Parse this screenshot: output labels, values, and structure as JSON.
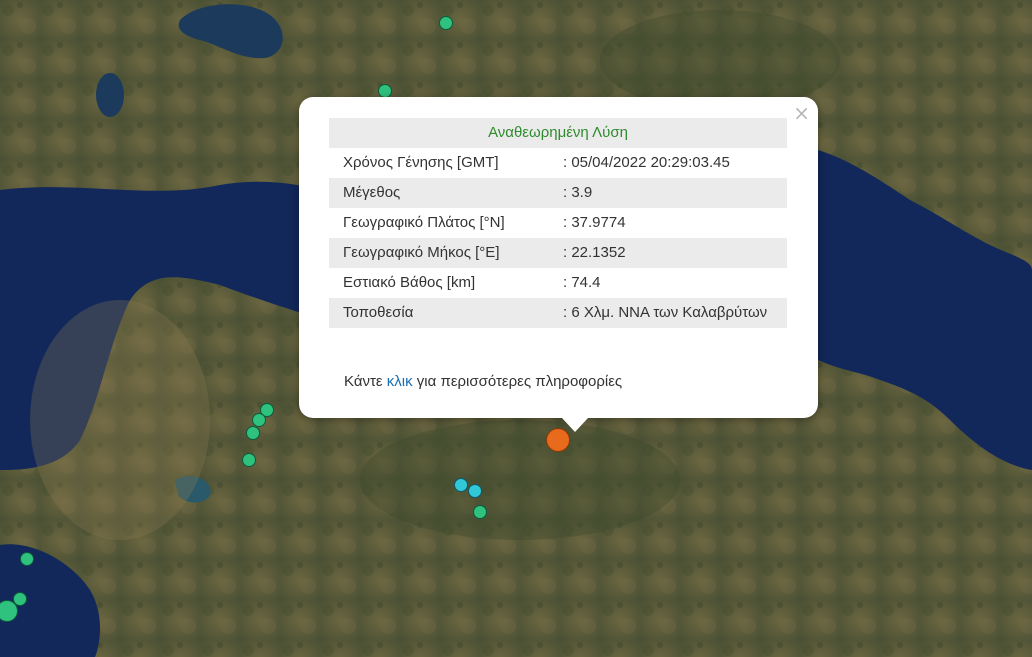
{
  "colors": {
    "sea": "#12285a",
    "land": "#5c5a38",
    "marker_green": "#2ec27e",
    "marker_cyan": "#31c8d8",
    "marker_orange": "#e86a1c",
    "title_green": "#2e8b2e",
    "link_blue": "#1a6eb5"
  },
  "popup": {
    "close_symbol": "×",
    "title": "Αναθεωρημένη Λύση",
    "rows": [
      {
        "label": "Χρόνος Γένησης [GMT]",
        "value": ": 05/04/2022 20:29:03.45"
      },
      {
        "label": "Μέγεθος",
        "value": ": 3.9"
      },
      {
        "label": "Γεωγραφικό Πλάτος [°N]",
        "value": ": 37.9774"
      },
      {
        "label": "Γεωγραφικό Μήκος [°E]",
        "value": ": 22.1352"
      },
      {
        "label": "Εστιακό Βάθος [km]",
        "value": ": 74.4"
      },
      {
        "label": "Τοποθεσία",
        "value": ": 6 Χλμ. ΝΝΑ των Καλαβρύτων"
      }
    ],
    "footer_before": "Κάντε ",
    "footer_link": "κλικ",
    "footer_after": " για περισσότερες πληροφορίες"
  }
}
